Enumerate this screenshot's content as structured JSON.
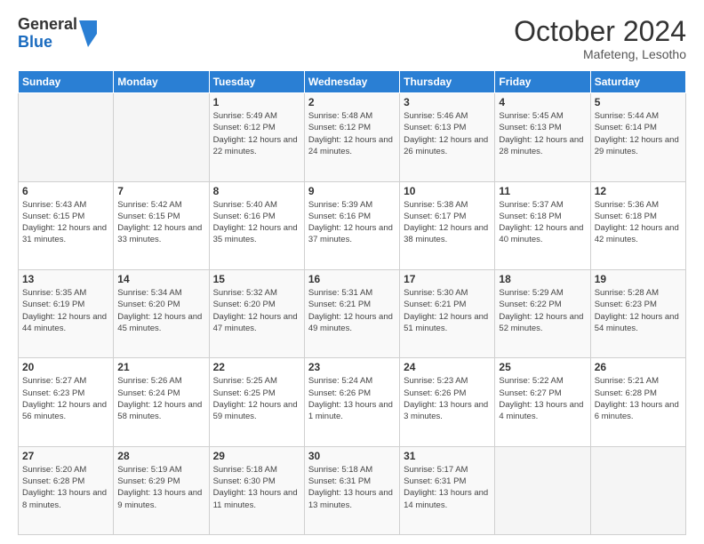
{
  "logo": {
    "general": "General",
    "blue": "Blue"
  },
  "title": "October 2024",
  "location": "Mafeteng, Lesotho",
  "days_of_week": [
    "Sunday",
    "Monday",
    "Tuesday",
    "Wednesday",
    "Thursday",
    "Friday",
    "Saturday"
  ],
  "weeks": [
    [
      {
        "day": "",
        "info": ""
      },
      {
        "day": "",
        "info": ""
      },
      {
        "day": "1",
        "info": "Sunrise: 5:49 AM\nSunset: 6:12 PM\nDaylight: 12 hours and 22 minutes."
      },
      {
        "day": "2",
        "info": "Sunrise: 5:48 AM\nSunset: 6:12 PM\nDaylight: 12 hours and 24 minutes."
      },
      {
        "day": "3",
        "info": "Sunrise: 5:46 AM\nSunset: 6:13 PM\nDaylight: 12 hours and 26 minutes."
      },
      {
        "day": "4",
        "info": "Sunrise: 5:45 AM\nSunset: 6:13 PM\nDaylight: 12 hours and 28 minutes."
      },
      {
        "day": "5",
        "info": "Sunrise: 5:44 AM\nSunset: 6:14 PM\nDaylight: 12 hours and 29 minutes."
      }
    ],
    [
      {
        "day": "6",
        "info": "Sunrise: 5:43 AM\nSunset: 6:15 PM\nDaylight: 12 hours and 31 minutes."
      },
      {
        "day": "7",
        "info": "Sunrise: 5:42 AM\nSunset: 6:15 PM\nDaylight: 12 hours and 33 minutes."
      },
      {
        "day": "8",
        "info": "Sunrise: 5:40 AM\nSunset: 6:16 PM\nDaylight: 12 hours and 35 minutes."
      },
      {
        "day": "9",
        "info": "Sunrise: 5:39 AM\nSunset: 6:16 PM\nDaylight: 12 hours and 37 minutes."
      },
      {
        "day": "10",
        "info": "Sunrise: 5:38 AM\nSunset: 6:17 PM\nDaylight: 12 hours and 38 minutes."
      },
      {
        "day": "11",
        "info": "Sunrise: 5:37 AM\nSunset: 6:18 PM\nDaylight: 12 hours and 40 minutes."
      },
      {
        "day": "12",
        "info": "Sunrise: 5:36 AM\nSunset: 6:18 PM\nDaylight: 12 hours and 42 minutes."
      }
    ],
    [
      {
        "day": "13",
        "info": "Sunrise: 5:35 AM\nSunset: 6:19 PM\nDaylight: 12 hours and 44 minutes."
      },
      {
        "day": "14",
        "info": "Sunrise: 5:34 AM\nSunset: 6:20 PM\nDaylight: 12 hours and 45 minutes."
      },
      {
        "day": "15",
        "info": "Sunrise: 5:32 AM\nSunset: 6:20 PM\nDaylight: 12 hours and 47 minutes."
      },
      {
        "day": "16",
        "info": "Sunrise: 5:31 AM\nSunset: 6:21 PM\nDaylight: 12 hours and 49 minutes."
      },
      {
        "day": "17",
        "info": "Sunrise: 5:30 AM\nSunset: 6:21 PM\nDaylight: 12 hours and 51 minutes."
      },
      {
        "day": "18",
        "info": "Sunrise: 5:29 AM\nSunset: 6:22 PM\nDaylight: 12 hours and 52 minutes."
      },
      {
        "day": "19",
        "info": "Sunrise: 5:28 AM\nSunset: 6:23 PM\nDaylight: 12 hours and 54 minutes."
      }
    ],
    [
      {
        "day": "20",
        "info": "Sunrise: 5:27 AM\nSunset: 6:23 PM\nDaylight: 12 hours and 56 minutes."
      },
      {
        "day": "21",
        "info": "Sunrise: 5:26 AM\nSunset: 6:24 PM\nDaylight: 12 hours and 58 minutes."
      },
      {
        "day": "22",
        "info": "Sunrise: 5:25 AM\nSunset: 6:25 PM\nDaylight: 12 hours and 59 minutes."
      },
      {
        "day": "23",
        "info": "Sunrise: 5:24 AM\nSunset: 6:26 PM\nDaylight: 13 hours and 1 minute."
      },
      {
        "day": "24",
        "info": "Sunrise: 5:23 AM\nSunset: 6:26 PM\nDaylight: 13 hours and 3 minutes."
      },
      {
        "day": "25",
        "info": "Sunrise: 5:22 AM\nSunset: 6:27 PM\nDaylight: 13 hours and 4 minutes."
      },
      {
        "day": "26",
        "info": "Sunrise: 5:21 AM\nSunset: 6:28 PM\nDaylight: 13 hours and 6 minutes."
      }
    ],
    [
      {
        "day": "27",
        "info": "Sunrise: 5:20 AM\nSunset: 6:28 PM\nDaylight: 13 hours and 8 minutes."
      },
      {
        "day": "28",
        "info": "Sunrise: 5:19 AM\nSunset: 6:29 PM\nDaylight: 13 hours and 9 minutes."
      },
      {
        "day": "29",
        "info": "Sunrise: 5:18 AM\nSunset: 6:30 PM\nDaylight: 13 hours and 11 minutes."
      },
      {
        "day": "30",
        "info": "Sunrise: 5:18 AM\nSunset: 6:31 PM\nDaylight: 13 hours and 13 minutes."
      },
      {
        "day": "31",
        "info": "Sunrise: 5:17 AM\nSunset: 6:31 PM\nDaylight: 13 hours and 14 minutes."
      },
      {
        "day": "",
        "info": ""
      },
      {
        "day": "",
        "info": ""
      }
    ]
  ]
}
